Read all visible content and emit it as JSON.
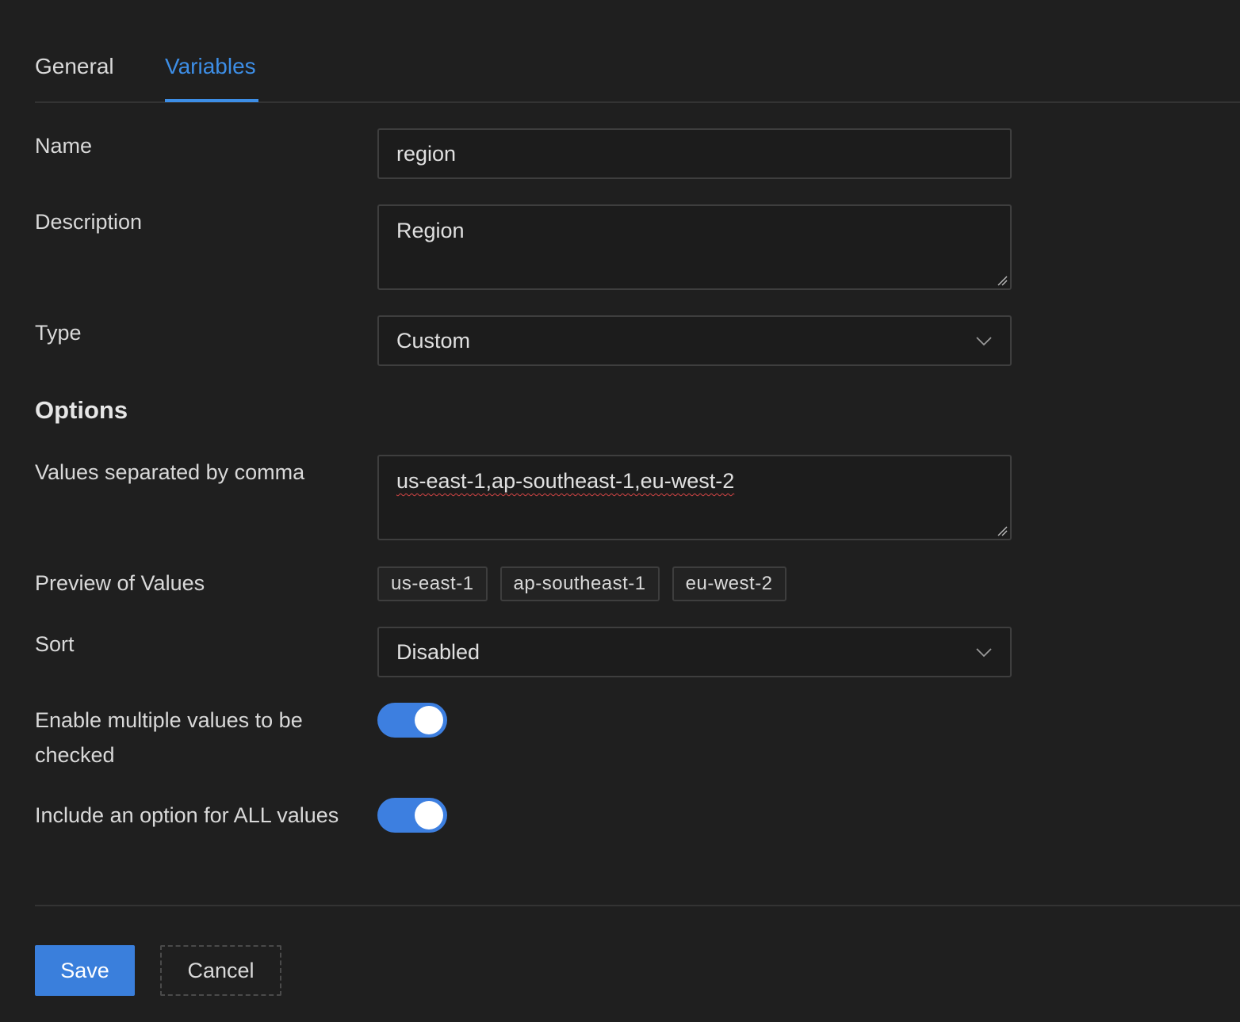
{
  "tabs": [
    {
      "label": "General",
      "active": false
    },
    {
      "label": "Variables",
      "active": true
    }
  ],
  "accent_color": "#3d8ee6",
  "form": {
    "name": {
      "label": "Name",
      "value": "region"
    },
    "description": {
      "label": "Description",
      "value": "Region"
    },
    "type": {
      "label": "Type",
      "selected": "Custom"
    },
    "options_title": "Options",
    "values": {
      "label": "Values separated by comma",
      "value": "us-east-1,ap-southeast-1,eu-west-2"
    },
    "preview": {
      "label": "Preview of Values",
      "tags": [
        "us-east-1",
        "ap-southeast-1",
        "eu-west-2"
      ]
    },
    "sort": {
      "label": "Sort",
      "selected": "Disabled"
    },
    "multi": {
      "label": "Enable multiple values to be checked",
      "enabled": true
    },
    "include_all": {
      "label": "Include an option for ALL values",
      "enabled": true
    }
  },
  "actions": {
    "save_label": "Save",
    "cancel_label": "Cancel"
  }
}
